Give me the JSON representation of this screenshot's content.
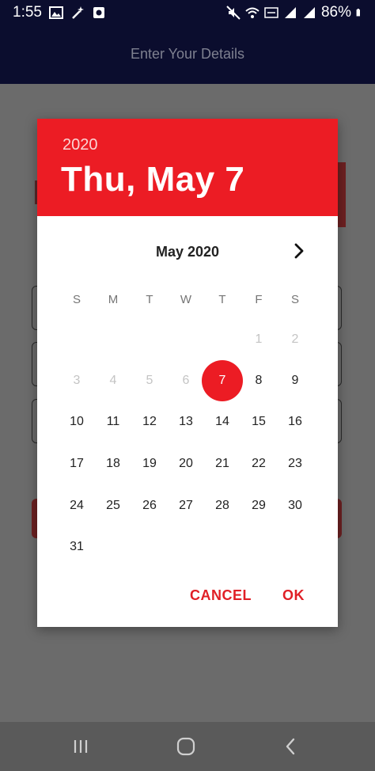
{
  "status_bar": {
    "time": "1:55",
    "battery": "86%",
    "left_icons": [
      "image-icon",
      "magic-wand-icon",
      "screen-record-icon"
    ],
    "right_icons": [
      "mute-icon",
      "wifi-icon",
      "volte-icon",
      "signal-icon",
      "signal-icon"
    ]
  },
  "app_bar": {
    "title": "Enter Your Details"
  },
  "dialog": {
    "year": "2020",
    "selected_date": "Thu, May 7",
    "month_label": "May 2020",
    "weekdays": [
      "S",
      "M",
      "T",
      "W",
      "T",
      "F",
      "S"
    ],
    "first_weekday_index": 5,
    "days": [
      "1",
      "2",
      "3",
      "4",
      "5",
      "6",
      "7",
      "8",
      "9",
      "10",
      "11",
      "12",
      "13",
      "14",
      "15",
      "16",
      "17",
      "18",
      "19",
      "20",
      "21",
      "22",
      "23",
      "24",
      "25",
      "26",
      "27",
      "28",
      "29",
      "30",
      "31"
    ],
    "disabled_through_day": 6,
    "selected_day": 7,
    "cancel_label": "CANCEL",
    "ok_label": "OK"
  },
  "colors": {
    "accent": "#ec1c24",
    "app_bar": "#0b0d2e",
    "scrim": "#6b6b6b"
  }
}
